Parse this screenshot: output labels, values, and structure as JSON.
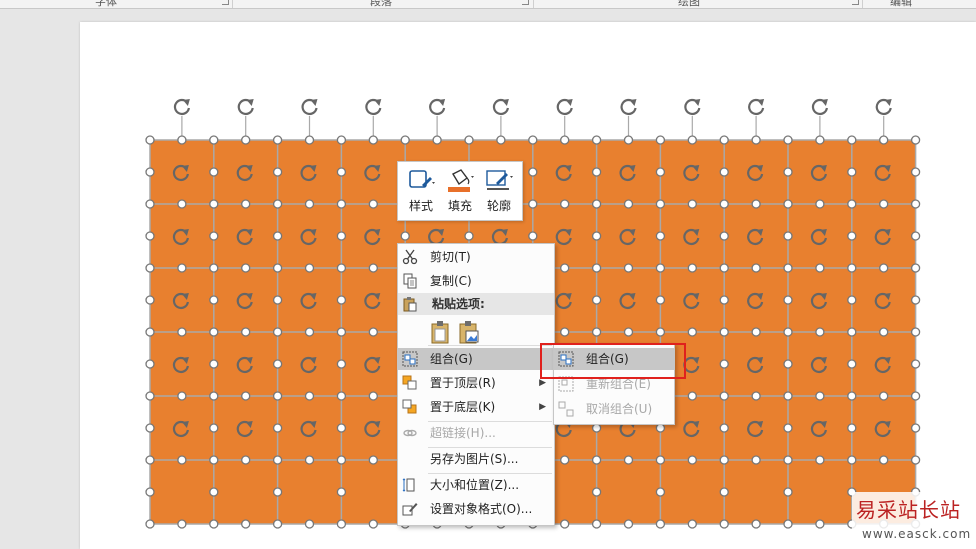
{
  "ribbon": {
    "groups": [
      "字体",
      "段落",
      "绘图",
      "编辑"
    ]
  },
  "mini_toolbar": {
    "style_label": "样式",
    "fill_label": "填充",
    "outline_label": "轮廓",
    "fill_color": "#e8702a"
  },
  "context_menu": {
    "items": [
      {
        "label": "剪切(T)",
        "icon": "scissors-icon"
      },
      {
        "label": "复制(C)",
        "icon": "copy-icon"
      },
      {
        "label": "粘贴选项:",
        "icon": "paste-icon"
      },
      {
        "label": "组合(G)",
        "icon": "group-icon",
        "highlighted": true,
        "submenu": true
      },
      {
        "label": "置于顶层(R)",
        "icon": "bring-to-front-icon",
        "submenu": true
      },
      {
        "label": "置于底层(K)",
        "icon": "send-to-back-icon",
        "submenu": true
      },
      {
        "label": "超链接(H)...",
        "icon": "link-icon",
        "disabled": true
      },
      {
        "label": "另存为图片(S)..."
      },
      {
        "label": "大小和位置(Z)...",
        "icon": "size-position-icon"
      },
      {
        "label": "设置对象格式(O)...",
        "icon": "format-object-icon"
      }
    ]
  },
  "submenu": {
    "items": [
      {
        "label": "组合(G)",
        "icon": "group-icon",
        "highlighted": true
      },
      {
        "label": "重新组合(E)",
        "icon": "regroup-icon",
        "disabled": true
      },
      {
        "label": "取消组合(U)",
        "icon": "ungroup-icon",
        "disabled": true
      }
    ]
  },
  "colors": {
    "shape_fill": "#e8802f",
    "grid_line": "#a9a9a9",
    "handle_outline": "#777777",
    "highlight": "#c7c7c7",
    "annotation_red": "#e0211d"
  },
  "watermark": {
    "title": "易采站长站",
    "url": "www.easck.com"
  }
}
